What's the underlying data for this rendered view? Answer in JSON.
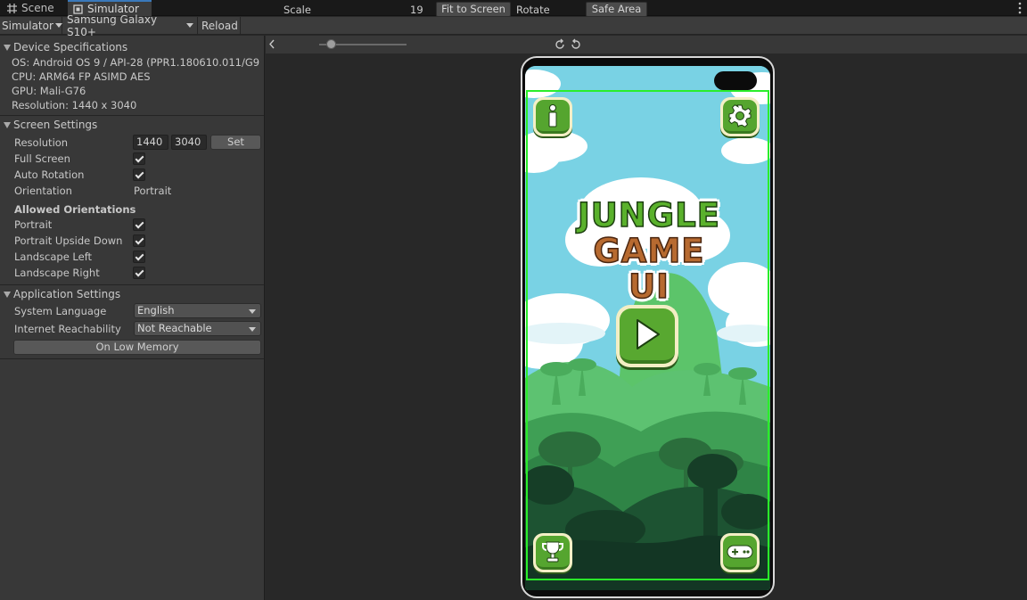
{
  "tabs": [
    {
      "label": "Scene",
      "active": false
    },
    {
      "label": "Simulator",
      "active": true
    }
  ],
  "toolbar": {
    "mode_label": "Simulator",
    "device_label": "Samsung Galaxy S10+",
    "reload_label": "Reload"
  },
  "device_specs": {
    "header": "Device Specifications",
    "os": "OS: Android OS 9 / API-28 (PPR1.180610.011/G9",
    "cpu": "CPU: ARM64 FP ASIMD AES",
    "gpu": "GPU: Mali-G76",
    "resolution": "Resolution: 1440 x 3040"
  },
  "screen_settings": {
    "header": "Screen Settings",
    "resolution_label": "Resolution",
    "width": "1440",
    "height": "3040",
    "set_label": "Set",
    "full_screen_label": "Full Screen",
    "full_screen": true,
    "auto_rotation_label": "Auto Rotation",
    "auto_rotation": true,
    "orientation_label": "Orientation",
    "orientation_value": "Portrait",
    "allowed_header": "Allowed Orientations",
    "portrait_label": "Portrait",
    "portrait_upside_label": "Portrait Upside Down",
    "landscape_left_label": "Landscape Left",
    "landscape_right_label": "Landscape Right"
  },
  "app_settings": {
    "header": "Application Settings",
    "system_language_label": "System Language",
    "system_language_value": "English",
    "internet_label": "Internet Reachability",
    "internet_value": "Not Reachable",
    "low_memory_label": "On Low Memory"
  },
  "view_toolbar": {
    "scale_label": "Scale",
    "scale_value": "19",
    "fit_label": "Fit to Screen",
    "rotate_label": "Rotate",
    "safe_area_label": "Safe Area"
  },
  "game": {
    "title_line1": "JUNGLE",
    "title_line2": "GAME UI",
    "info_icon": "info-icon",
    "settings_icon": "gear-icon",
    "play_icon": "play-icon",
    "trophy_icon": "trophy-icon",
    "gamepad_icon": "gamepad-icon"
  },
  "colors": {
    "safe_area": "#2aee2a",
    "sky": "#79d2e4",
    "button_green": "#55a52f",
    "button_rim": "#f4efc6"
  }
}
